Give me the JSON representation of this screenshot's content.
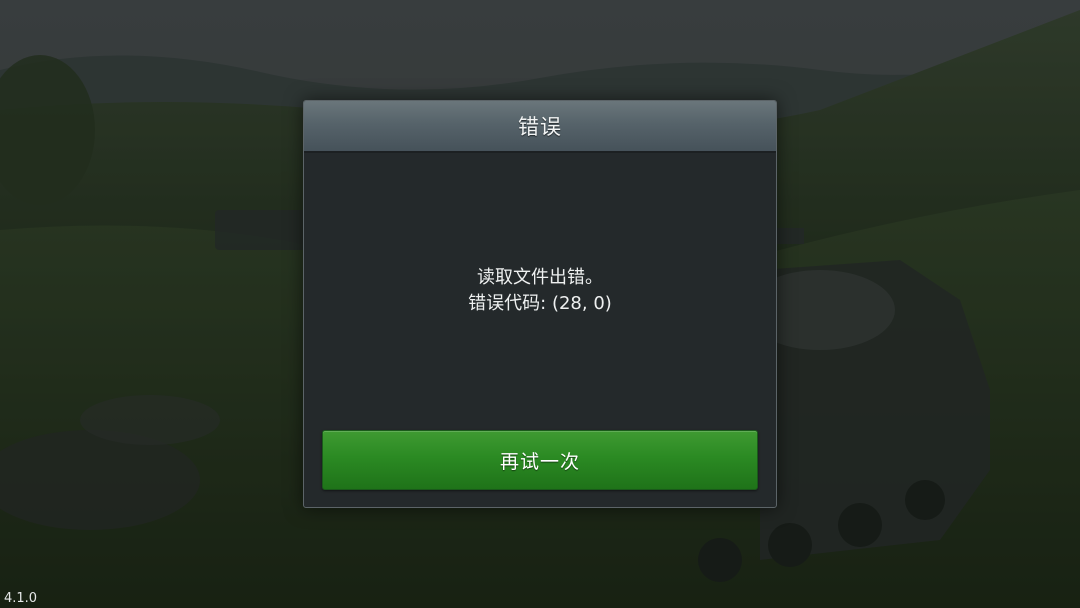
{
  "dialog": {
    "title": "错误",
    "message_line1": "读取文件出错。",
    "message_line2": "错误代码: (28, 0)",
    "retry_label": "再试一次"
  },
  "version": "4.1.0",
  "colors": {
    "header": "#56636a",
    "body": "#24292b",
    "button": "#2b8a23"
  }
}
